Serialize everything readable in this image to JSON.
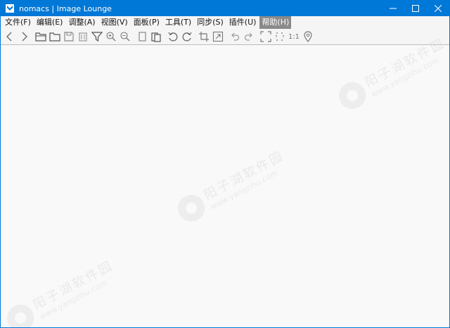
{
  "window": {
    "title": "nomacs | Image Lounge",
    "accent_color": "#0078d7"
  },
  "menu": {
    "items": [
      {
        "id": "file",
        "label": "文件(F)"
      },
      {
        "id": "edit",
        "label": "编辑(E)"
      },
      {
        "id": "adjust",
        "label": "调整(A)"
      },
      {
        "id": "view",
        "label": "视图(V)"
      },
      {
        "id": "panels",
        "label": "面板(P)"
      },
      {
        "id": "tools",
        "label": "工具(T)"
      },
      {
        "id": "sync",
        "label": "同步(S)"
      },
      {
        "id": "plugins",
        "label": "插件(U)"
      },
      {
        "id": "help",
        "label": "帮助(H)",
        "active": true
      }
    ]
  },
  "toolbar": {
    "icons": [
      "previous-icon",
      "next-icon",
      "open-icon",
      "open-folder-icon",
      "save-icon",
      "delete-icon",
      "filter-icon",
      "zoom-in-icon",
      "zoom-out-icon",
      "copy-icon",
      "paste-icon",
      "rotate-left-icon",
      "rotate-right-icon",
      "crop-icon",
      "resize-icon",
      "undo-icon",
      "redo-icon",
      "fullscreen-icon",
      "fit-icon",
      "actual-size-icon",
      "location-icon"
    ],
    "actual_size_label": "1:1"
  },
  "watermark": {
    "text": "阳子湖软件园",
    "url": "www.yangzihu.com"
  }
}
